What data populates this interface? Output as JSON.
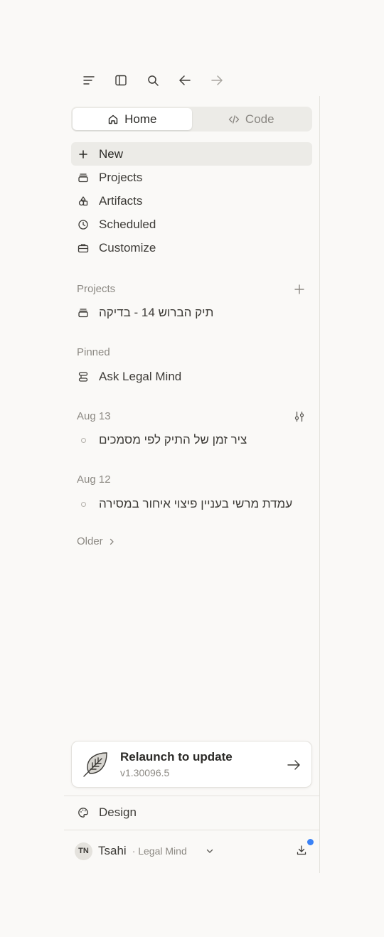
{
  "tabs": [
    {
      "label": "Home",
      "icon": "home-icon",
      "active": true
    },
    {
      "label": "Code",
      "icon": "code-icon",
      "active": false
    }
  ],
  "nav": [
    {
      "label": "New",
      "icon": "plus-icon"
    },
    {
      "label": "Projects",
      "icon": "folder-icon"
    },
    {
      "label": "Artifacts",
      "icon": "shapes-icon"
    },
    {
      "label": "Scheduled",
      "icon": "clock-icon"
    },
    {
      "label": "Customize",
      "icon": "briefcase-icon"
    }
  ],
  "projects": {
    "label": "Projects",
    "items": [
      {
        "label": "תיק הברוש 14 - בדיקה",
        "icon": "folder-icon"
      }
    ]
  },
  "pinned": {
    "label": "Pinned",
    "items": [
      {
        "label": "Ask Legal Mind",
        "icon": "stack-icon"
      }
    ]
  },
  "history": [
    {
      "date": "Aug 13",
      "items": [
        "ציר זמן של התיק לפי מסמכים"
      ]
    },
    {
      "date": "Aug 12",
      "items": [
        "עמדת מרשי בעניין פיצוי איחור במסירה"
      ]
    }
  ],
  "older_label": "Older",
  "update": {
    "title": "Relaunch to update",
    "version": "v1.30096.5"
  },
  "design_label": "Design",
  "user": {
    "initials": "TN",
    "name": "Tsahi",
    "org": "· Legal Mind"
  },
  "colors": {
    "accent_badge": "#3b82f6",
    "sidebar_bg": "#faf9f7",
    "active_bg": "#ecebe7"
  }
}
